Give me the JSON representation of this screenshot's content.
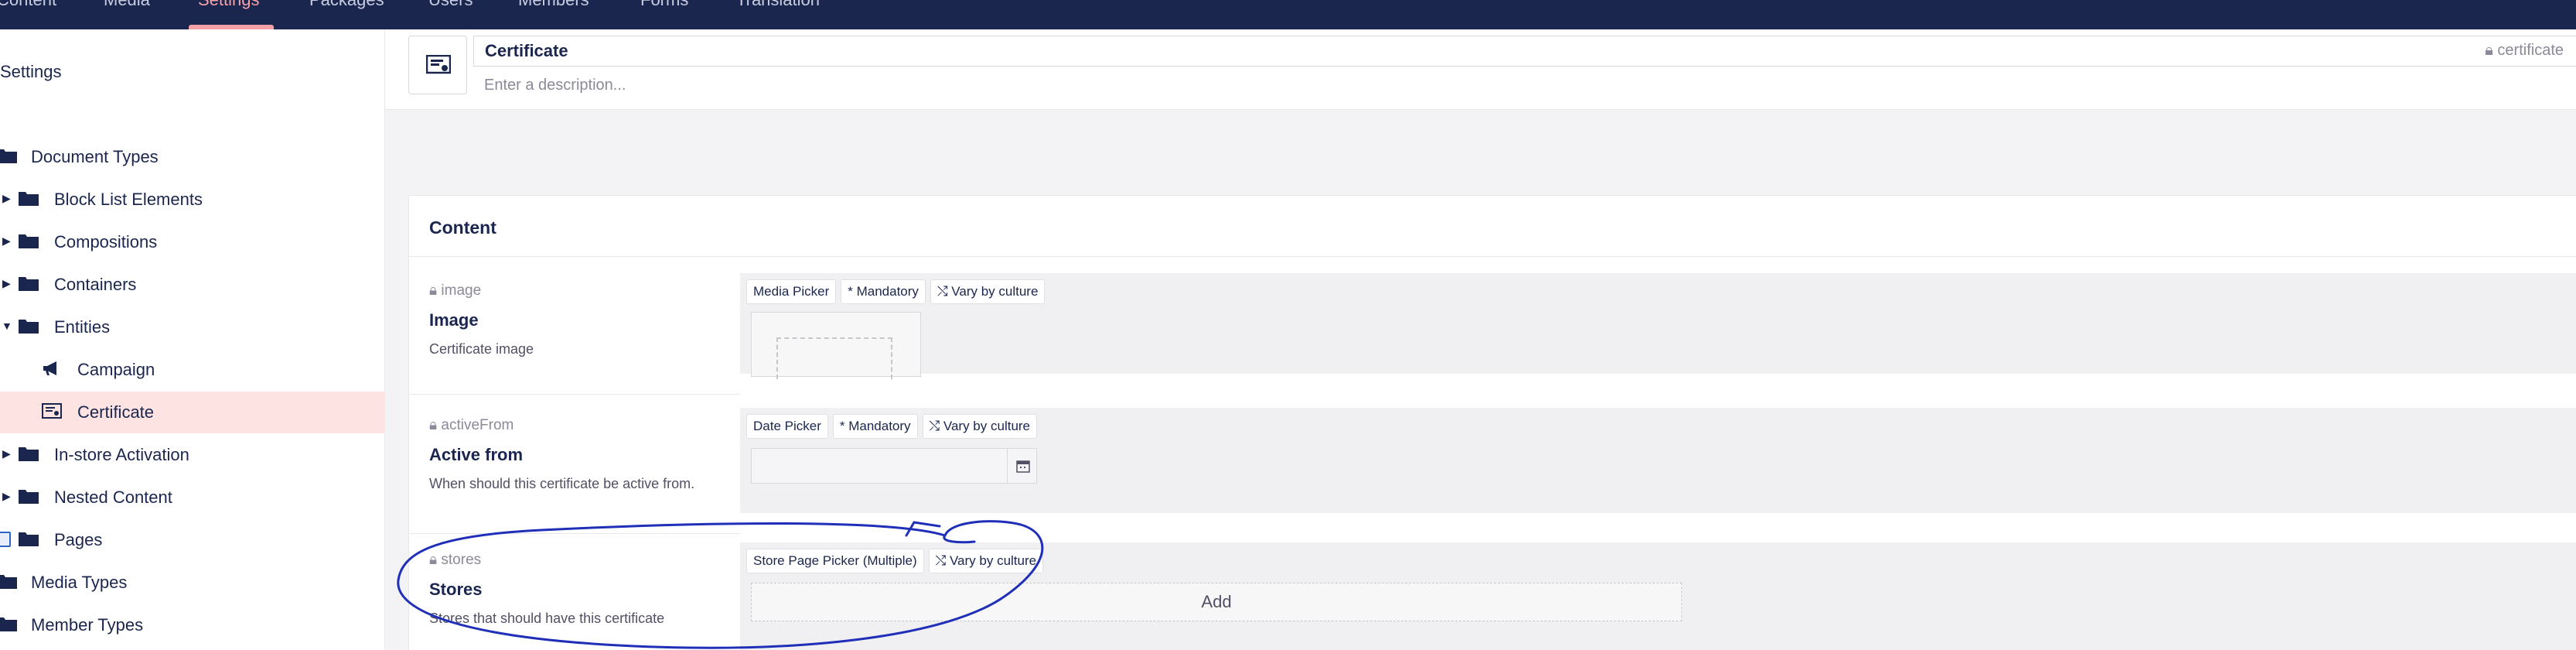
{
  "topnav": {
    "items": [
      "Content",
      "Media",
      "Settings",
      "Packages",
      "Users",
      "Members",
      "Forms",
      "Translation"
    ],
    "active": "Settings"
  },
  "sidebar": {
    "title": "Settings",
    "items": [
      {
        "label": "Document Types"
      },
      {
        "label": "Block List Elements"
      },
      {
        "label": "Compositions"
      },
      {
        "label": "Containers"
      },
      {
        "label": "Entities"
      },
      {
        "label": "Campaign"
      },
      {
        "label": "Certificate"
      },
      {
        "label": "In-store Activation"
      },
      {
        "label": "Nested Content"
      },
      {
        "label": "Pages"
      },
      {
        "label": "Media Types"
      },
      {
        "label": "Member Types"
      }
    ]
  },
  "header": {
    "name": "Certificate",
    "alias": "certificate",
    "description_placeholder": "Enter a description..."
  },
  "card": {
    "title": "Content",
    "properties": [
      {
        "alias": "image",
        "label": "Image",
        "description": "Certificate image",
        "tags": [
          "Media Picker",
          "* Mandatory",
          "Vary by culture"
        ]
      },
      {
        "alias": "activeFrom",
        "label": "Active from",
        "description": "When should this certificate be active from.",
        "tags": [
          "Date Picker",
          "* Mandatory",
          "Vary by culture"
        ]
      },
      {
        "alias": "stores",
        "label": "Stores",
        "description": "Stores that should have this certificate",
        "tags": [
          "Store Page Picker (Multiple)",
          "Vary by culture"
        ],
        "add_label": "Add"
      }
    ]
  },
  "colors": {
    "nav_bg": "#1b264f",
    "active_accent": "#f5a1a8",
    "selected_row": "#fde4e2",
    "annotation_ink": "#1f2fb8"
  }
}
